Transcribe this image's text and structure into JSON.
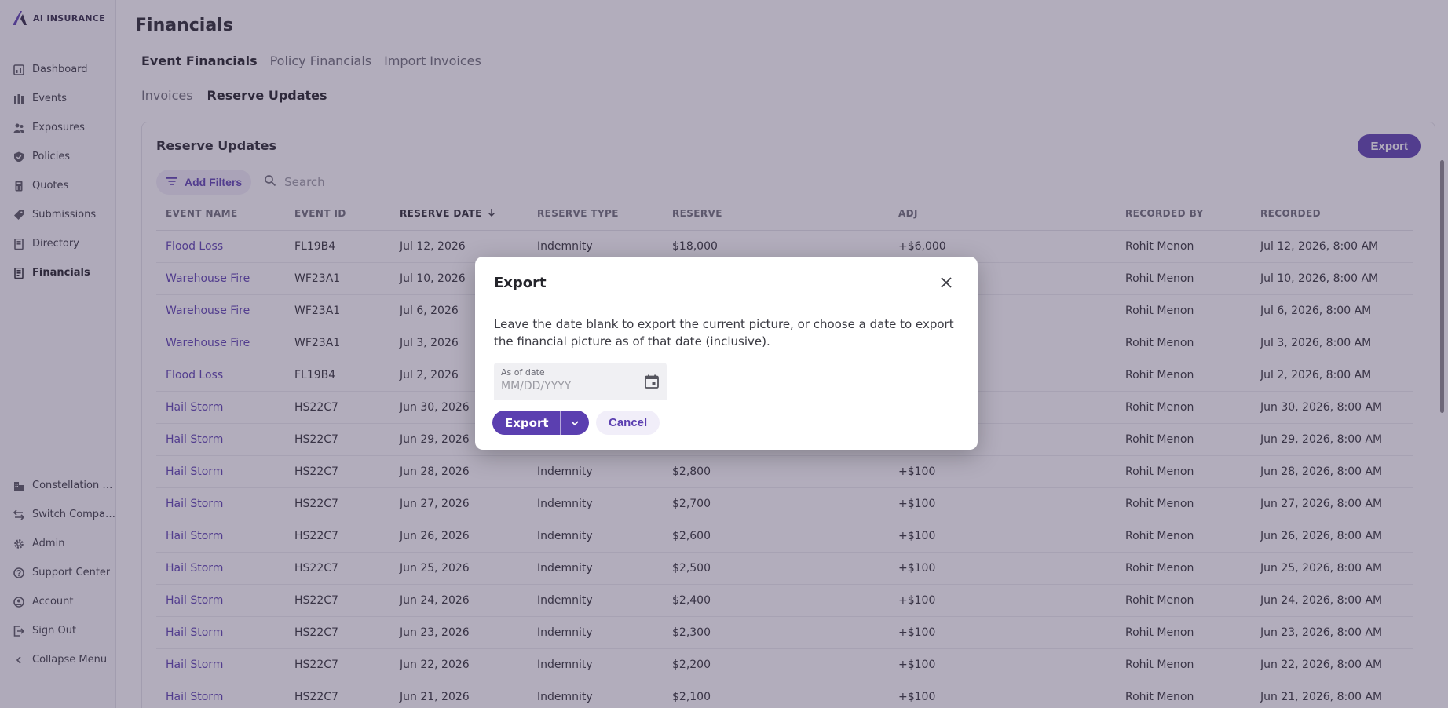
{
  "brand": {
    "name": "AI INSURANCE"
  },
  "sidebar": {
    "items": [
      {
        "label": "Dashboard",
        "icon": "dashboard-icon"
      },
      {
        "label": "Events",
        "icon": "events-icon"
      },
      {
        "label": "Exposures",
        "icon": "exposures-icon"
      },
      {
        "label": "Policies",
        "icon": "shield-icon"
      },
      {
        "label": "Quotes",
        "icon": "quotes-icon"
      },
      {
        "label": "Submissions",
        "icon": "tag-icon"
      },
      {
        "label": "Directory",
        "icon": "book-icon"
      },
      {
        "label": "Financials",
        "icon": "financials-icon"
      }
    ],
    "bottom": [
      {
        "label": "Constellation C...",
        "icon": "building-icon"
      },
      {
        "label": "Switch Company",
        "icon": "switch-icon"
      },
      {
        "label": "Admin",
        "icon": "gear-icon"
      },
      {
        "label": "Support Center",
        "icon": "help-icon"
      },
      {
        "label": "Account",
        "icon": "user-icon"
      },
      {
        "label": "Sign Out",
        "icon": "sign-out-icon"
      },
      {
        "label": "Collapse Menu",
        "icon": "chevron-left-icon"
      }
    ]
  },
  "page": {
    "title": "Financials",
    "tabs": [
      "Event Financials",
      "Policy Financials",
      "Import Invoices"
    ],
    "subtabs": [
      "Invoices",
      "Reserve Updates"
    ]
  },
  "card": {
    "title": "Reserve Updates",
    "export_label": "Export",
    "add_filters_label": "Add Filters",
    "search_placeholder": "Search"
  },
  "table": {
    "columns": [
      "EVENT NAME",
      "EVENT ID",
      "RESERVE DATE",
      "RESERVE TYPE",
      "RESERVE",
      "ADJ",
      "RECORDED BY",
      "RECORDED"
    ],
    "rows": [
      [
        "Flood Loss",
        "FL19B4",
        "Jul 12, 2026",
        "Indemnity",
        "$18,000",
        "+$6,000",
        "Rohit Menon",
        "Jul 12, 2026, 8:00 AM"
      ],
      [
        "Warehouse Fire",
        "WF23A1",
        "Jul 10, 2026",
        "",
        "",
        "",
        "Rohit Menon",
        "Jul 10, 2026, 8:00 AM"
      ],
      [
        "Warehouse Fire",
        "WF23A1",
        "Jul 6, 2026",
        "",
        "",
        "",
        "Rohit Menon",
        "Jul 6, 2026, 8:00 AM"
      ],
      [
        "Warehouse Fire",
        "WF23A1",
        "Jul 3, 2026",
        "",
        "",
        "",
        "Rohit Menon",
        "Jul 3, 2026, 8:00 AM"
      ],
      [
        "Flood Loss",
        "FL19B4",
        "Jul 2, 2026",
        "",
        "",
        "",
        "Rohit Menon",
        "Jul 2, 2026, 8:00 AM"
      ],
      [
        "Hail Storm",
        "HS22C7",
        "Jun 30, 2026",
        "",
        "",
        "",
        "Rohit Menon",
        "Jun 30, 2026, 8:00 AM"
      ],
      [
        "Hail Storm",
        "HS22C7",
        "Jun 29, 2026",
        "",
        "",
        "",
        "Rohit Menon",
        "Jun 29, 2026, 8:00 AM"
      ],
      [
        "Hail Storm",
        "HS22C7",
        "Jun 28, 2026",
        "Indemnity",
        "$2,800",
        "+$100",
        "Rohit Menon",
        "Jun 28, 2026, 8:00 AM"
      ],
      [
        "Hail Storm",
        "HS22C7",
        "Jun 27, 2026",
        "Indemnity",
        "$2,700",
        "+$100",
        "Rohit Menon",
        "Jun 27, 2026, 8:00 AM"
      ],
      [
        "Hail Storm",
        "HS22C7",
        "Jun 26, 2026",
        "Indemnity",
        "$2,600",
        "+$100",
        "Rohit Menon",
        "Jun 26, 2026, 8:00 AM"
      ],
      [
        "Hail Storm",
        "HS22C7",
        "Jun 25, 2026",
        "Indemnity",
        "$2,500",
        "+$100",
        "Rohit Menon",
        "Jun 25, 2026, 8:00 AM"
      ],
      [
        "Hail Storm",
        "HS22C7",
        "Jun 24, 2026",
        "Indemnity",
        "$2,400",
        "+$100",
        "Rohit Menon",
        "Jun 24, 2026, 8:00 AM"
      ],
      [
        "Hail Storm",
        "HS22C7",
        "Jun 23, 2026",
        "Indemnity",
        "$2,300",
        "+$100",
        "Rohit Menon",
        "Jun 23, 2026, 8:00 AM"
      ],
      [
        "Hail Storm",
        "HS22C7",
        "Jun 22, 2026",
        "Indemnity",
        "$2,200",
        "+$100",
        "Rohit Menon",
        "Jun 22, 2026, 8:00 AM"
      ],
      [
        "Hail Storm",
        "HS22C7",
        "Jun 21, 2026",
        "Indemnity",
        "$2,100",
        "+$100",
        "Rohit Menon",
        "Jun 21, 2026, 8:00 AM"
      ]
    ]
  },
  "modal": {
    "title": "Export",
    "body": "Leave the date blank to export the current picture, or choose a date to export the financial picture as of that date (inclusive).",
    "date_label": "As of date",
    "date_placeholder": "MM/DD/YYYY",
    "export_label": "Export",
    "cancel_label": "Cancel"
  },
  "colors": {
    "accent": "#5b3fb0",
    "accent_light": "#f1eef9",
    "overlay": "#483c60"
  }
}
